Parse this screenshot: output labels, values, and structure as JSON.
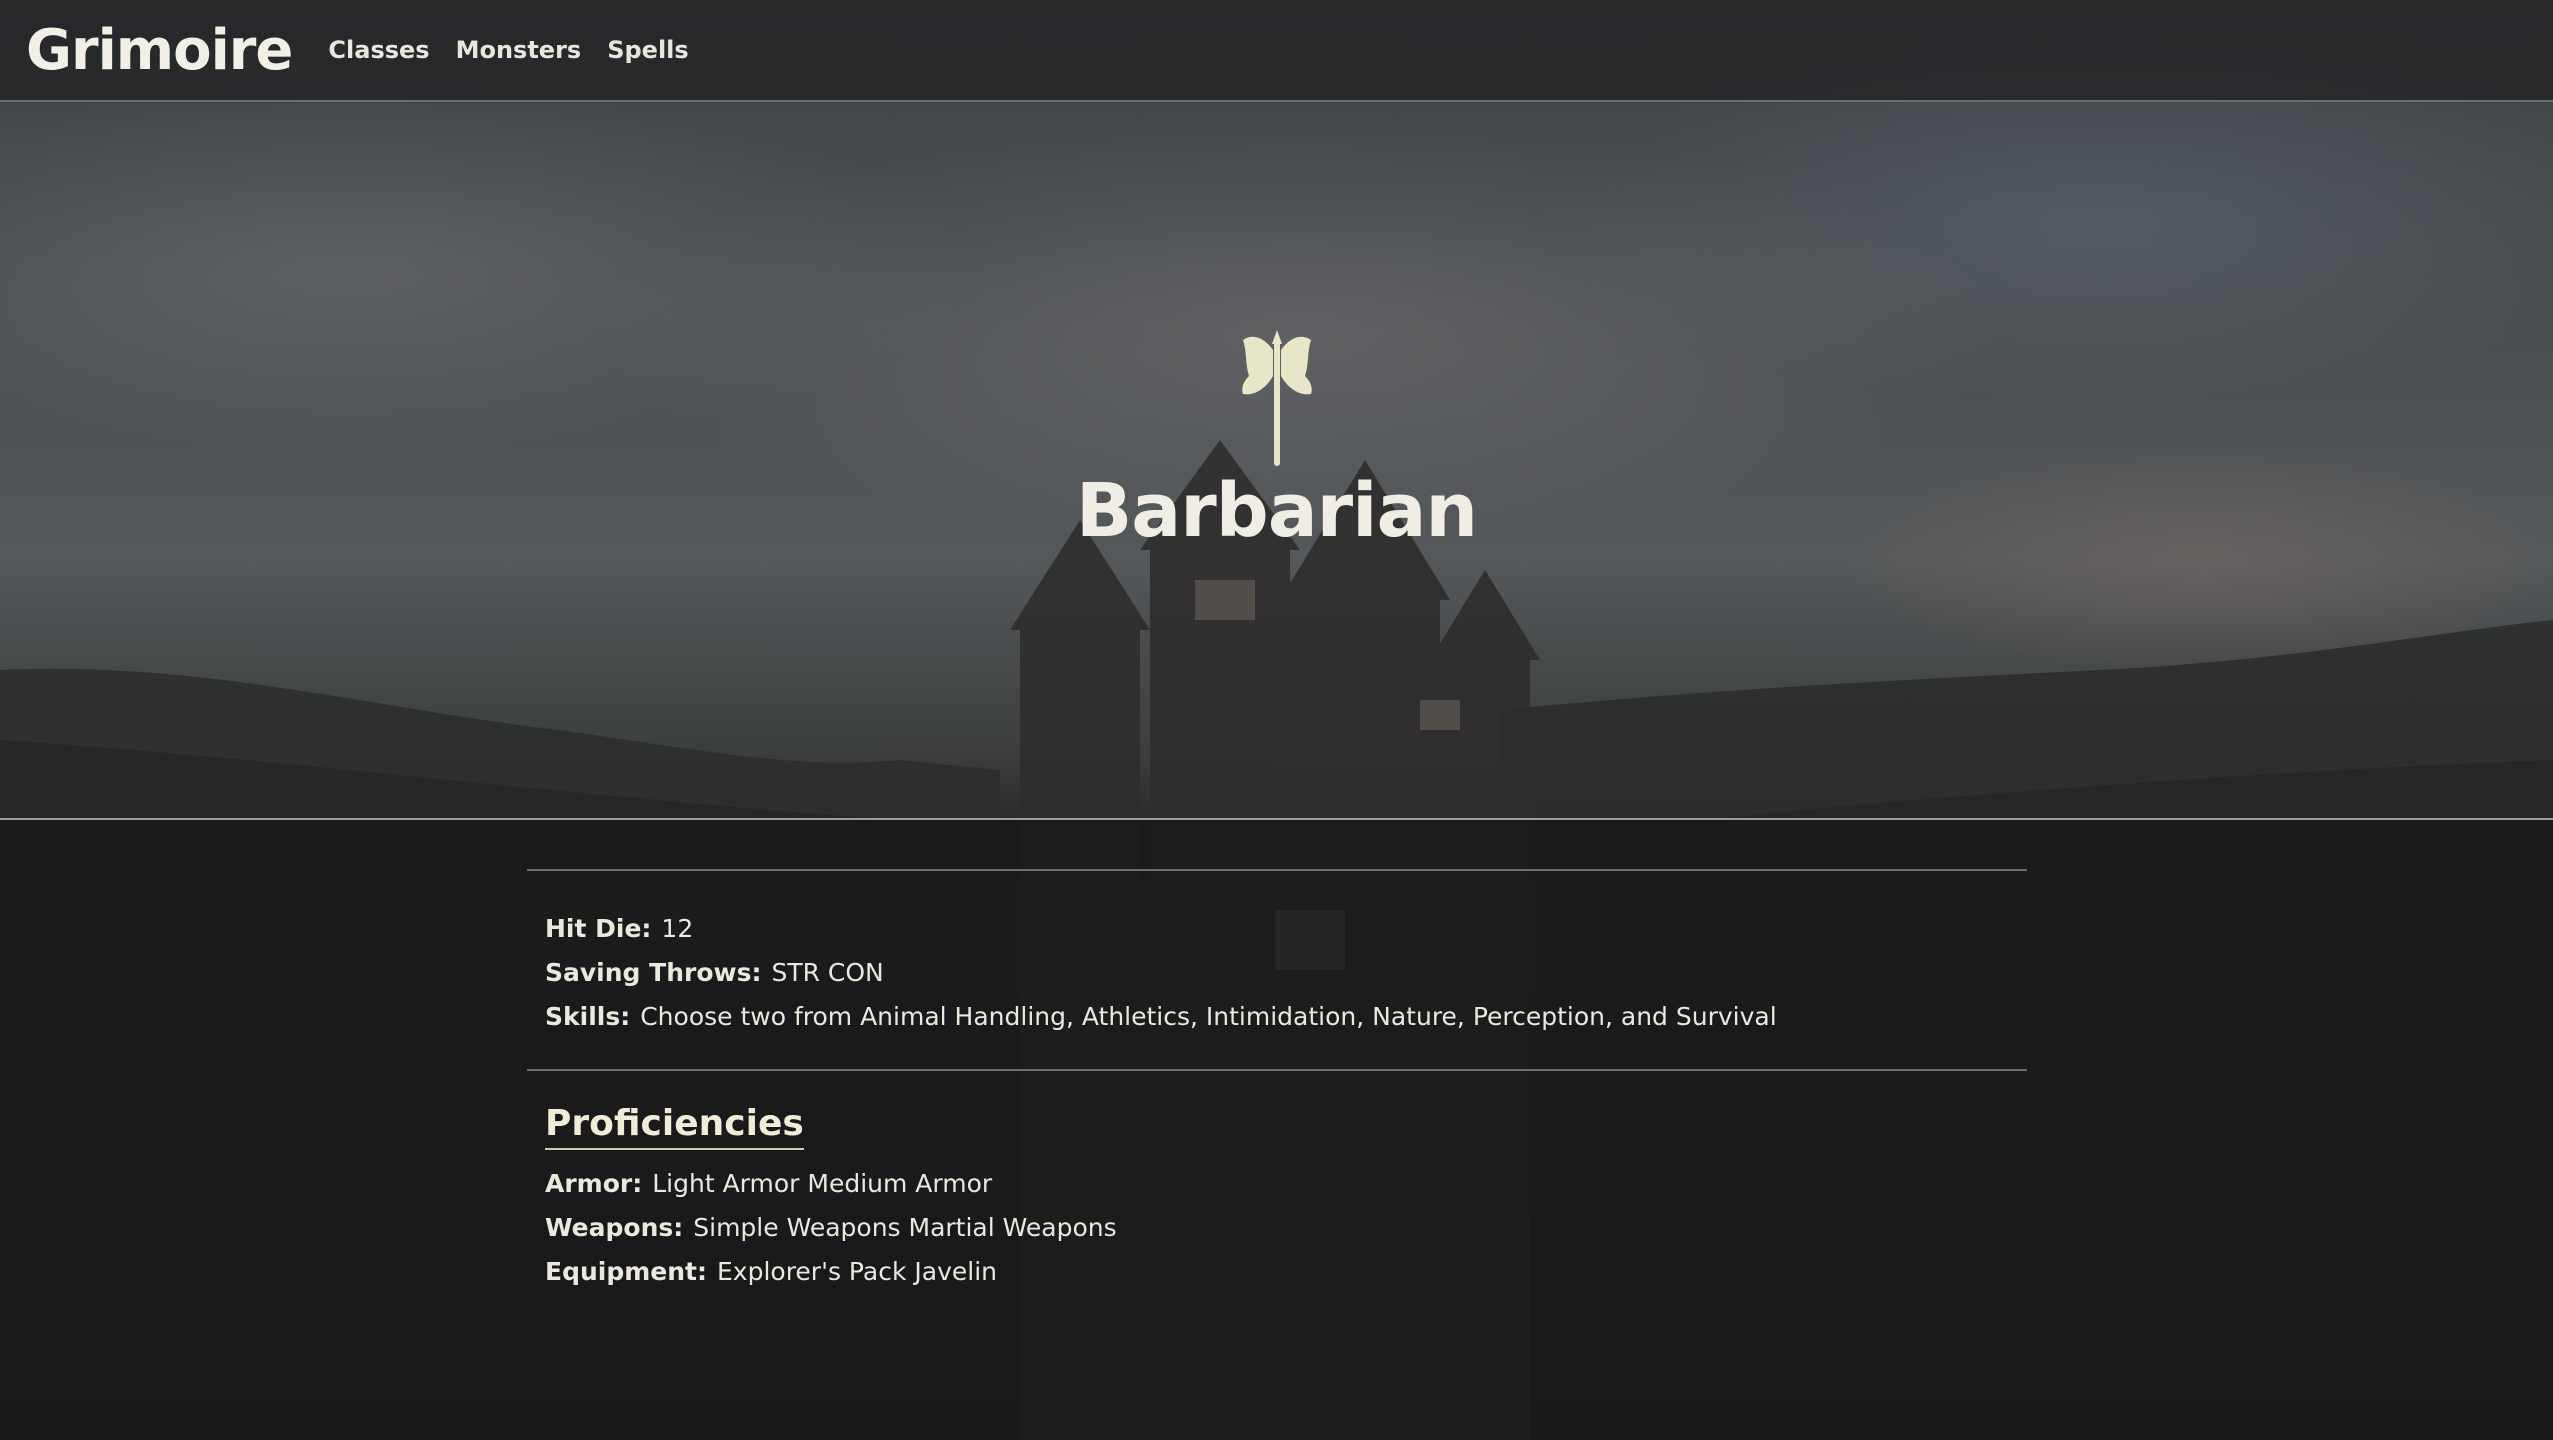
{
  "nav": {
    "brand": "Grimoire",
    "links": [
      "Classes",
      "Monsters",
      "Spells"
    ]
  },
  "hero": {
    "icon": "battle-axe-icon",
    "title": "Barbarian"
  },
  "stats": [
    {
      "label": "Hit Die:",
      "value": "12"
    },
    {
      "label": "Saving Throws:",
      "value": "STR CON"
    },
    {
      "label": "Skills:",
      "value": "Choose two from Animal Handling, Athletics, Intimidation, Nature, Perception, and Survival"
    }
  ],
  "proficiencies": {
    "title": "Proficiencies",
    "items": [
      {
        "label": "Armor:",
        "value": "Light Armor Medium Armor"
      },
      {
        "label": "Weapons:",
        "value": "Simple Weapons Martial Weapons"
      },
      {
        "label": "Equipment:",
        "value": "Explorer's Pack Javelin"
      }
    ]
  },
  "colors": {
    "accent": "#e8e6c8",
    "text": "#ebe8de"
  }
}
